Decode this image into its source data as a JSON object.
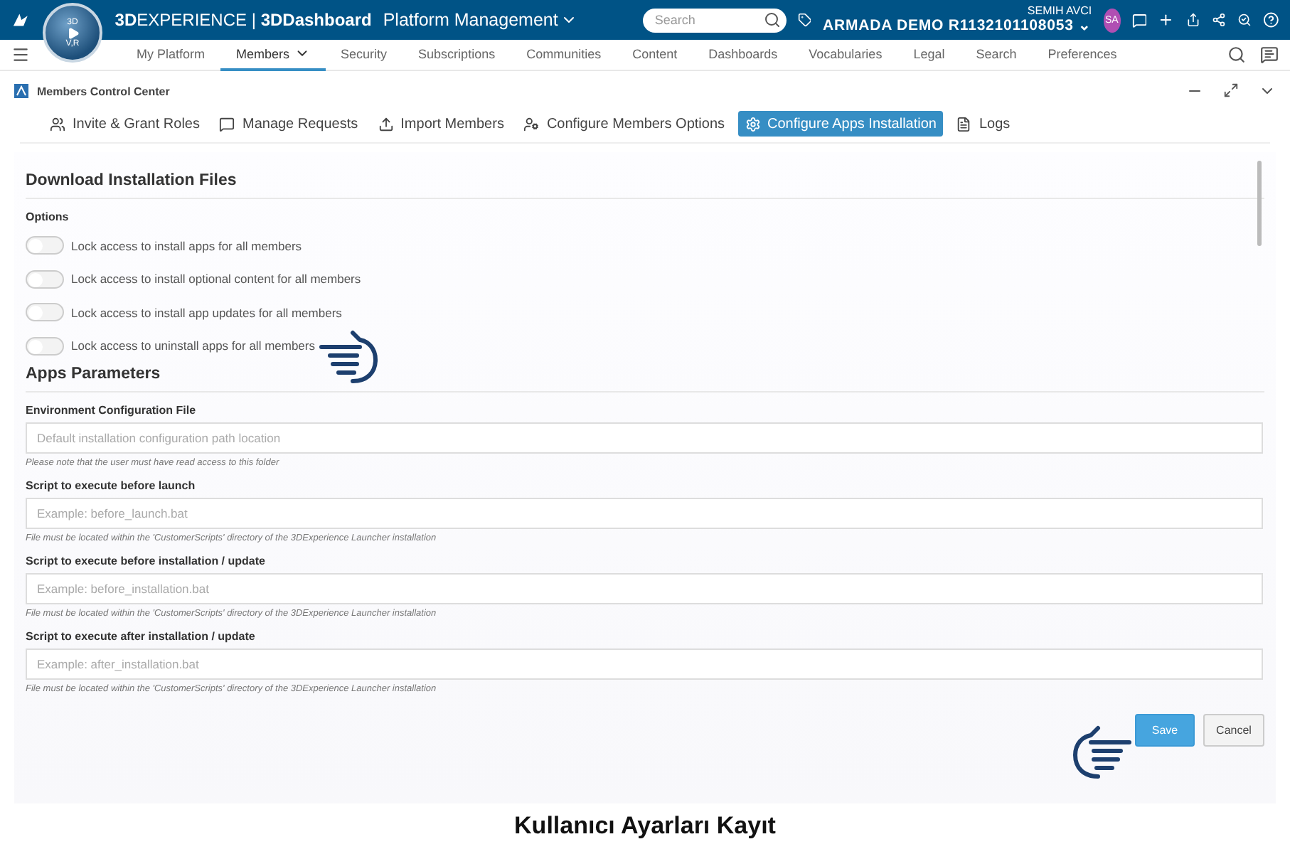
{
  "topbar": {
    "compass": {
      "top": "3D",
      "bottom": "V,R"
    },
    "brand_prefix": "3D",
    "brand_rest": "EXPERIENCE",
    "separator": "|",
    "app": "3DDashboard",
    "dashboard": "Platform Management",
    "search": {
      "placeholder": "Search"
    },
    "user": "SEMIH AVCI",
    "tenant": "ARMADA DEMO R1132101108053",
    "tenant_caret": "⌄",
    "avatar": "SA"
  },
  "nav": [
    {
      "label": "My Platform",
      "selected": false
    },
    {
      "label": "Members",
      "selected": true,
      "dropdown": true
    },
    {
      "label": "Security",
      "selected": false
    },
    {
      "label": "Subscriptions",
      "selected": false
    },
    {
      "label": "Communities",
      "selected": false
    },
    {
      "label": "Content",
      "selected": false
    },
    {
      "label": "Dashboards",
      "selected": false
    },
    {
      "label": "Vocabularies",
      "selected": false
    },
    {
      "label": "Legal",
      "selected": false
    },
    {
      "label": "Search",
      "selected": false
    },
    {
      "label": "Preferences",
      "selected": false
    }
  ],
  "widget": {
    "title": "Members Control Center"
  },
  "tabs": [
    {
      "label": "Invite & Grant Roles",
      "selected": false
    },
    {
      "label": "Manage Requests",
      "selected": false
    },
    {
      "label": "Import Members",
      "selected": false
    },
    {
      "label": "Configure Members Options",
      "selected": false
    },
    {
      "label": "Configure Apps Installation",
      "selected": true
    },
    {
      "label": "Logs",
      "selected": false
    }
  ],
  "download": {
    "title": "Download Installation Files",
    "options_label": "Options",
    "options": [
      {
        "label": "Lock access to install apps for all members",
        "on": false
      },
      {
        "label": "Lock access to install optional content for all members",
        "on": false
      },
      {
        "label": "Lock access to install app updates for all members",
        "on": false
      },
      {
        "label": "Lock access to uninstall apps for all members",
        "on": false
      }
    ]
  },
  "params": {
    "title": "Apps Parameters",
    "fields": [
      {
        "label": "Environment Configuration File",
        "placeholder": "Default installation configuration path location",
        "note": "Please note that the user must have read access to this folder"
      },
      {
        "label": "Script to execute before launch",
        "placeholder": "Example: before_launch.bat",
        "note": "File must be located within the 'CustomerScripts' directory of the 3DExperience Launcher installation"
      },
      {
        "label": "Script to execute before installation / update",
        "placeholder": "Example: before_installation.bat",
        "note": "File must be located within the 'CustomerScripts' directory of the 3DExperience Launcher installation"
      },
      {
        "label": "Script to execute after installation / update",
        "placeholder": "Example: after_installation.bat",
        "note": "File must be located within the 'CustomerScripts' directory of the 3DExperience Launcher installation"
      }
    ]
  },
  "buttons": [
    {
      "label": "Save",
      "kind": "primary"
    },
    {
      "label": "Cancel",
      "kind": "secondary"
    }
  ],
  "caption": "Kullanıcı Ayarları Kayıt"
}
